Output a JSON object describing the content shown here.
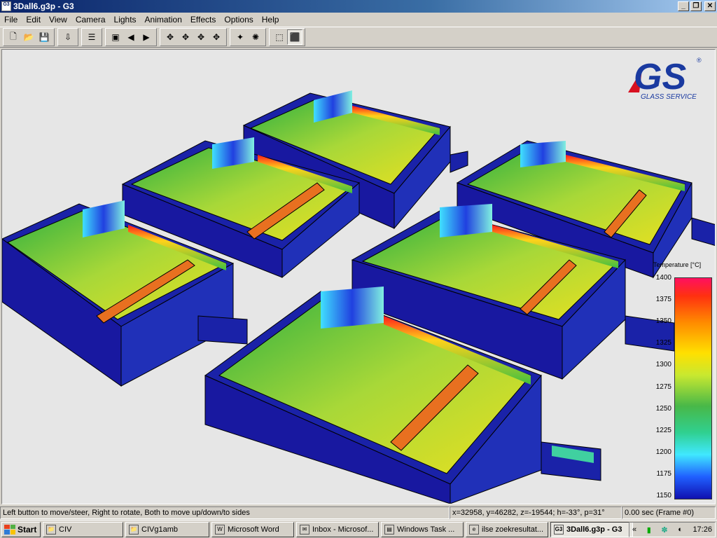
{
  "window": {
    "title": "3Dall6.g3p - G3",
    "app_icon_text": "G3"
  },
  "menu": [
    "File",
    "Edit",
    "View",
    "Camera",
    "Lights",
    "Animation",
    "Effects",
    "Options",
    "Help"
  ],
  "toolbar": {
    "groups": [
      [
        {
          "name": "new-icon",
          "glyph": "🗋"
        },
        {
          "name": "open-icon",
          "glyph": "📂"
        },
        {
          "name": "save-icon",
          "glyph": "💾"
        }
      ],
      [
        {
          "name": "import-icon",
          "glyph": "⇩"
        }
      ],
      [
        {
          "name": "layers-icon",
          "glyph": "☰"
        }
      ],
      [
        {
          "name": "render-icon",
          "glyph": "▣"
        },
        {
          "name": "step-back-icon",
          "glyph": "◀"
        },
        {
          "name": "play-icon",
          "glyph": "▶"
        }
      ],
      [
        {
          "name": "camera-icon-1",
          "glyph": "✥"
        },
        {
          "name": "camera-icon-2",
          "glyph": "✥"
        },
        {
          "name": "camera-icon-3",
          "glyph": "✥"
        },
        {
          "name": "camera-icon-4",
          "glyph": "✥"
        }
      ],
      [
        {
          "name": "light-icon-1",
          "glyph": "✦"
        },
        {
          "name": "light-icon-2",
          "glyph": "✺"
        }
      ],
      [
        {
          "name": "wireframe-icon",
          "glyph": "⬚"
        },
        {
          "name": "solid-icon",
          "glyph": "⬛"
        }
      ]
    ]
  },
  "logo": {
    "letters": "GS",
    "subtitle": "GLASS SERVICE",
    "mark": "®"
  },
  "legend": {
    "title": "Temperature [°C]",
    "ticks": [
      "1400",
      "1375",
      "1350",
      "1325",
      "1300",
      "1275",
      "1250",
      "1225",
      "1200",
      "1175",
      "1150"
    ]
  },
  "status": {
    "hint": "Left button to move/steer, Right to rotate, Both to move up/down/to sides",
    "coords": "x=32958, y=46282, z=-19544; h=-33°, p=31°",
    "time": "0.00 sec (Frame #0)"
  },
  "taskbar": {
    "start_label": "Start",
    "tasks": [
      {
        "label": "CIV",
        "icon": "folder-icon",
        "glyph": "📁"
      },
      {
        "label": "CIVg1amb",
        "icon": "folder-icon",
        "glyph": "📁"
      },
      {
        "label": "Microsoft Word",
        "icon": "word-icon",
        "glyph": "W"
      },
      {
        "label": "Inbox - Microsof...",
        "icon": "outlook-icon",
        "glyph": "✉"
      },
      {
        "label": "Windows Task ...",
        "icon": "task-manager-icon",
        "glyph": "▤"
      },
      {
        "label": "ilse zoekresultat...",
        "icon": "browser-icon",
        "glyph": "e"
      },
      {
        "label": "3Dall6.g3p - G3",
        "icon": "g3-icon",
        "glyph": "G3",
        "active": true
      }
    ],
    "tray_expand": "«",
    "clock": "17:26"
  },
  "colors": {
    "furnace_blue": "#1a22a8",
    "hot_red": "#ff2020",
    "warm_yellow": "#e8e020",
    "mid_green": "#30b040"
  }
}
